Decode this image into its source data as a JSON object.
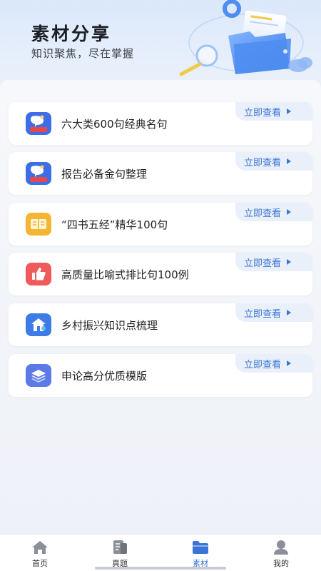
{
  "header": {
    "title": "素材分享",
    "subtitle": "知识聚焦，尽在掌握"
  },
  "view_label": "立即查看",
  "cards": [
    {
      "label": "六大类600句经典名句",
      "icon": "six-categories-icon",
      "icon_text": "六大类",
      "color": "#3d6ee8"
    },
    {
      "label": "报告必备金句整理",
      "icon": "six-categories-icon",
      "icon_text": "六大类",
      "color": "#3d6ee8"
    },
    {
      "label": "“四书五经”精华100句",
      "icon": "book-icon",
      "color": "#f4b632"
    },
    {
      "label": "高质量比喻式排比句100例",
      "icon": "thumbs-up-icon",
      "color": "#ef5a5a"
    },
    {
      "label": "乡村振兴知识点梳理",
      "icon": "house-icon",
      "color": "#3d7be6"
    },
    {
      "label": "申论高分优质模版",
      "icon": "layers-icon",
      "color": "#5b7ae6"
    }
  ],
  "tabs": [
    {
      "label": "首页",
      "icon": "home-icon"
    },
    {
      "label": "真题",
      "icon": "document-icon"
    },
    {
      "label": "素材",
      "icon": "folder-icon",
      "active": true
    },
    {
      "label": "我的",
      "icon": "profile-icon"
    }
  ],
  "colors": {
    "accent": "#3a74d6",
    "background": "#eef1f7",
    "card": "#ffffff",
    "view_button_bg": "#eaf0f9"
  }
}
